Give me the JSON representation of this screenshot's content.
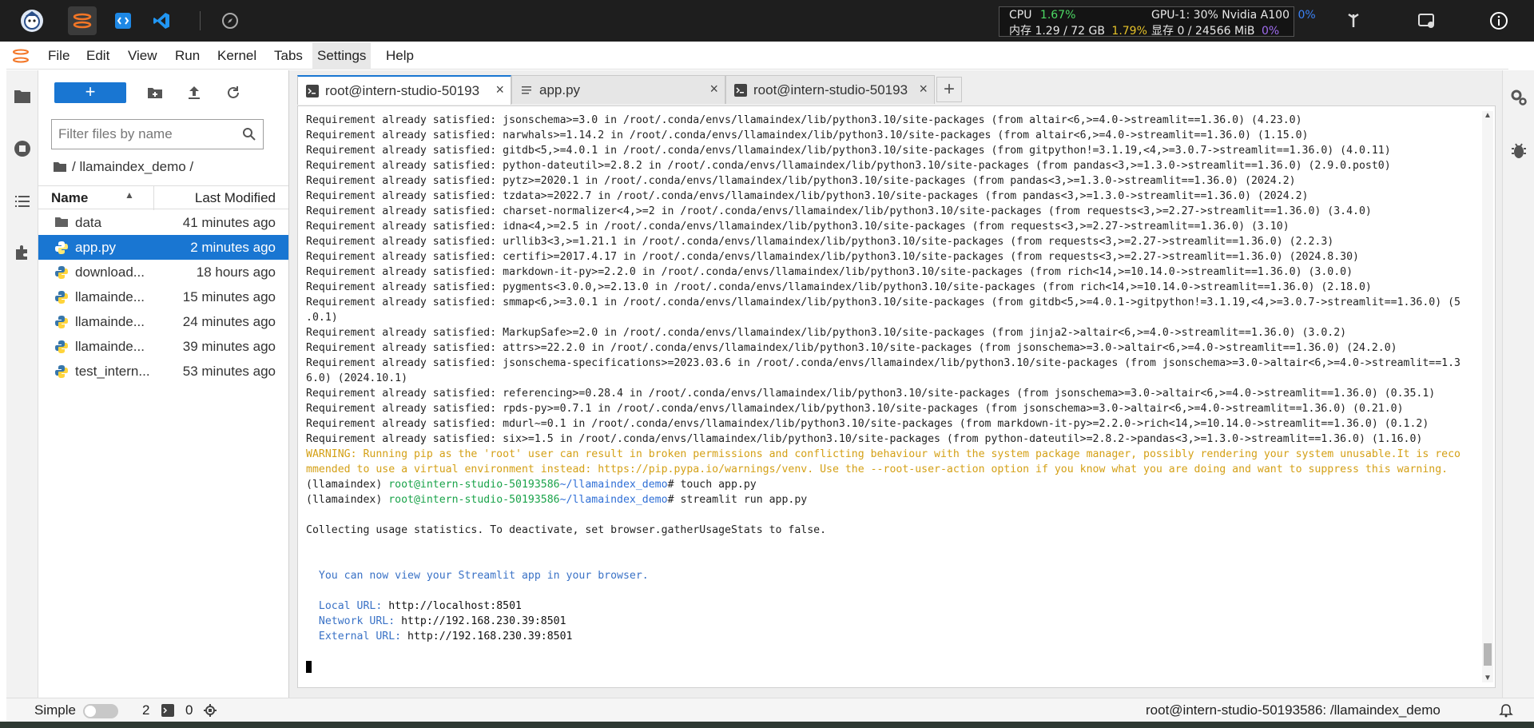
{
  "stats": {
    "cpu_label": "CPU",
    "cpu_value": "1.67%",
    "mem_label": "内存 1.29 / 72 GB",
    "mem_value": "1.79%",
    "gpu_label": "GPU-1: 30% Nvidia A100",
    "gpu_value": "0%",
    "vram_label": "显存 0 / 24566 MiB",
    "vram_value": "0%"
  },
  "menu": [
    "File",
    "Edit",
    "View",
    "Run",
    "Kernel",
    "Tabs",
    "Settings",
    "Help"
  ],
  "filebrowser": {
    "new_label": "+",
    "filter_placeholder": "Filter files by name",
    "breadcrumb": "/ llamaindex_demo /",
    "col_name": "Name",
    "col_modified": "Last Modified",
    "files": [
      {
        "name": "data",
        "modified": "41 minutes ago",
        "kind": "folder"
      },
      {
        "name": "app.py",
        "modified": "2 minutes ago",
        "kind": "python"
      },
      {
        "name": "download...",
        "modified": "18 hours ago",
        "kind": "python"
      },
      {
        "name": "llamainde...",
        "modified": "15 minutes ago",
        "kind": "python"
      },
      {
        "name": "llamainde...",
        "modified": "24 minutes ago",
        "kind": "python"
      },
      {
        "name": "llamainde...",
        "modified": "39 minutes ago",
        "kind": "python"
      },
      {
        "name": "test_intern...",
        "modified": "53 minutes ago",
        "kind": "python"
      }
    ]
  },
  "tabs": [
    {
      "label": "root@intern-studio-50193",
      "close": "×"
    },
    {
      "label": "app.py",
      "close": "×"
    },
    {
      "label": "root@intern-studio-50193",
      "close": "×"
    }
  ],
  "tab_add": "+",
  "terminal": {
    "lines": [
      "Requirement already satisfied: jsonschema>=3.0 in /root/.conda/envs/llamaindex/lib/python3.10/site-packages (from altair<6,>=4.0->streamlit==1.36.0) (4.23.0)",
      "Requirement already satisfied: narwhals>=1.14.2 in /root/.conda/envs/llamaindex/lib/python3.10/site-packages (from altair<6,>=4.0->streamlit==1.36.0) (1.15.0)",
      "Requirement already satisfied: gitdb<5,>=4.0.1 in /root/.conda/envs/llamaindex/lib/python3.10/site-packages (from gitpython!=3.1.19,<4,>=3.0.7->streamlit==1.36.0) (4.0.11)",
      "Requirement already satisfied: python-dateutil>=2.8.2 in /root/.conda/envs/llamaindex/lib/python3.10/site-packages (from pandas<3,>=1.3.0->streamlit==1.36.0) (2.9.0.post0)",
      "Requirement already satisfied: pytz>=2020.1 in /root/.conda/envs/llamaindex/lib/python3.10/site-packages (from pandas<3,>=1.3.0->streamlit==1.36.0) (2024.2)",
      "Requirement already satisfied: tzdata>=2022.7 in /root/.conda/envs/llamaindex/lib/python3.10/site-packages (from pandas<3,>=1.3.0->streamlit==1.36.0) (2024.2)",
      "Requirement already satisfied: charset-normalizer<4,>=2 in /root/.conda/envs/llamaindex/lib/python3.10/site-packages (from requests<3,>=2.27->streamlit==1.36.0) (3.4.0)",
      "Requirement already satisfied: idna<4,>=2.5 in /root/.conda/envs/llamaindex/lib/python3.10/site-packages (from requests<3,>=2.27->streamlit==1.36.0) (3.10)",
      "Requirement already satisfied: urllib3<3,>=1.21.1 in /root/.conda/envs/llamaindex/lib/python3.10/site-packages (from requests<3,>=2.27->streamlit==1.36.0) (2.2.3)",
      "Requirement already satisfied: certifi>=2017.4.17 in /root/.conda/envs/llamaindex/lib/python3.10/site-packages (from requests<3,>=2.27->streamlit==1.36.0) (2024.8.30)",
      "Requirement already satisfied: markdown-it-py>=2.2.0 in /root/.conda/envs/llamaindex/lib/python3.10/site-packages (from rich<14,>=10.14.0->streamlit==1.36.0) (3.0.0)",
      "Requirement already satisfied: pygments<3.0.0,>=2.13.0 in /root/.conda/envs/llamaindex/lib/python3.10/site-packages (from rich<14,>=10.14.0->streamlit==1.36.0) (2.18.0)",
      "Requirement already satisfied: smmap<6,>=3.0.1 in /root/.conda/envs/llamaindex/lib/python3.10/site-packages (from gitdb<5,>=4.0.1->gitpython!=3.1.19,<4,>=3.0.7->streamlit==1.36.0) (5",
      ".0.1)",
      "Requirement already satisfied: MarkupSafe>=2.0 in /root/.conda/envs/llamaindex/lib/python3.10/site-packages (from jinja2->altair<6,>=4.0->streamlit==1.36.0) (3.0.2)",
      "Requirement already satisfied: attrs>=22.2.0 in /root/.conda/envs/llamaindex/lib/python3.10/site-packages (from jsonschema>=3.0->altair<6,>=4.0->streamlit==1.36.0) (24.2.0)",
      "Requirement already satisfied: jsonschema-specifications>=2023.03.6 in /root/.conda/envs/llamaindex/lib/python3.10/site-packages (from jsonschema>=3.0->altair<6,>=4.0->streamlit==1.3",
      "6.0) (2024.10.1)",
      "Requirement already satisfied: referencing>=0.28.4 in /root/.conda/envs/llamaindex/lib/python3.10/site-packages (from jsonschema>=3.0->altair<6,>=4.0->streamlit==1.36.0) (0.35.1)",
      "Requirement already satisfied: rpds-py>=0.7.1 in /root/.conda/envs/llamaindex/lib/python3.10/site-packages (from jsonschema>=3.0->altair<6,>=4.0->streamlit==1.36.0) (0.21.0)",
      "Requirement already satisfied: mdurl~=0.1 in /root/.conda/envs/llamaindex/lib/python3.10/site-packages (from markdown-it-py>=2.2.0->rich<14,>=10.14.0->streamlit==1.36.0) (0.1.2)",
      "Requirement already satisfied: six>=1.5 in /root/.conda/envs/llamaindex/lib/python3.10/site-packages (from python-dateutil>=2.8.2->pandas<3,>=1.3.0->streamlit==1.36.0) (1.16.0)"
    ],
    "warning_lines": [
      "WARNING: Running pip as the 'root' user can result in broken permissions and conflicting behaviour with the system package manager, possibly rendering your system unusable.It is reco",
      "mmended to use a virtual environment instead: https://pip.pypa.io/warnings/venv. Use the --root-user-action option if you know what you are doing and want to suppress this warning."
    ],
    "prompt_env": "(llamaindex) ",
    "prompt_user": "root@intern-studio-50193586",
    "prompt_path": "~/llamaindex_demo",
    "cmd1": "# touch app.py",
    "cmd2": "# streamlit run app.py",
    "collecting": "Collecting usage statistics. To deactivate, set browser.gatherUsageStats to false.",
    "view_msg": "  You can now view your Streamlit app in your browser.",
    "local_label": "  Local URL: ",
    "local_url": "http://localhost:8501",
    "network_label": "  Network URL: ",
    "network_url": "http://192.168.230.39:8501",
    "external_label": "  External URL: ",
    "external_url": "http://192.168.230.39:8501"
  },
  "statusbar": {
    "mode": "Simple",
    "terminals_count": "2",
    "kernels_count": "0",
    "path": "root@intern-studio-50193586: /llamaindex_demo"
  },
  "colors": {
    "accent": "#1976d2",
    "warning": "#d4a016",
    "prompt_user": "#1aa34a",
    "prompt_path": "#2f6fd6"
  }
}
